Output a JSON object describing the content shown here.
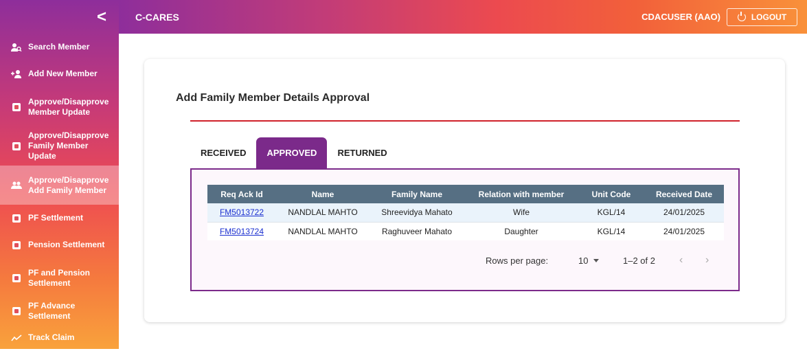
{
  "app": {
    "title": "C-CARES",
    "user": "CDACUSER (AAO)",
    "logout_label": "LOGOUT"
  },
  "sidebar": {
    "collapse_glyph": "<",
    "items": [
      {
        "label": "Search Member",
        "icon": "search-user-icon"
      },
      {
        "label": "Add New Member",
        "icon": "add-user-icon"
      },
      {
        "label": "Approve/Disapprove Member Update",
        "icon": "form-icon"
      },
      {
        "label": "Approve/Disapprove Family Member Update",
        "icon": "form-icon"
      },
      {
        "label": "Approve/Disapprove Add Family Member",
        "icon": "group-icon",
        "active": true
      },
      {
        "label": "PF Settlement",
        "icon": "form-icon"
      },
      {
        "label": "Pension Settlement",
        "icon": "form-icon"
      },
      {
        "label": "PF and Pension Settlement",
        "icon": "form-icon"
      },
      {
        "label": "PF Advance Settlement",
        "icon": "form-icon"
      },
      {
        "label": "Track Claim",
        "icon": "trend-icon"
      }
    ]
  },
  "page": {
    "heading": "Add Family Member Details Approval",
    "tabs": [
      {
        "label": "RECEIVED"
      },
      {
        "label": "APPROVED",
        "active": true
      },
      {
        "label": "RETURNED"
      }
    ],
    "table": {
      "columns": [
        "Req Ack Id",
        "Name",
        "Family Name",
        "Relation with member",
        "Unit Code",
        "Received Date"
      ],
      "rows": [
        [
          "FM5013722",
          "NANDLAL MAHTO",
          "Shreevidya Mahato",
          "Wife",
          "KGL/14",
          "24/01/2025"
        ],
        [
          "FM5013724",
          "NANDLAL MAHTO",
          "Raghuveer Mahato",
          "Daughter",
          "KGL/14",
          "24/01/2025"
        ]
      ]
    },
    "pagination": {
      "rows_per_page_label": "Rows per page:",
      "rows_per_page": "10",
      "range": "1–2 of 2",
      "prev": "‹",
      "next": "›"
    }
  },
  "colors": {
    "accent": "#7b2a8a",
    "red_rule": "#d0202a",
    "table_header": "#566f83"
  }
}
